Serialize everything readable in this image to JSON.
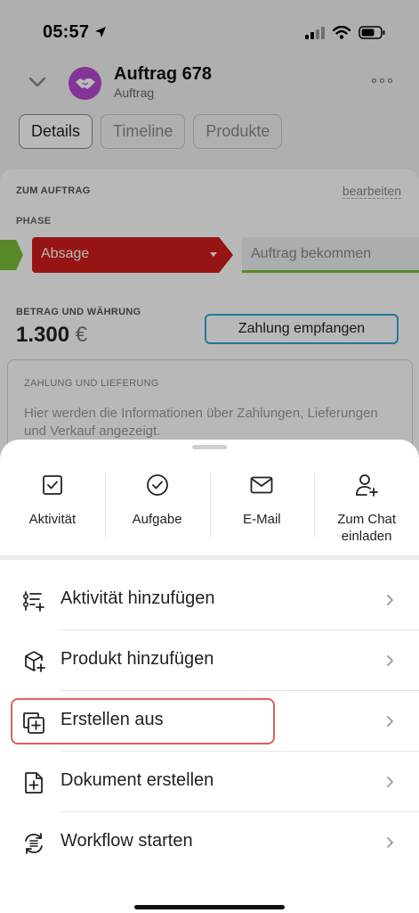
{
  "status_bar": {
    "time": "05:57"
  },
  "header": {
    "title": "Auftrag 678",
    "subtitle": "Auftrag"
  },
  "tabs": [
    {
      "label": "Details"
    },
    {
      "label": "Timeline"
    },
    {
      "label": "Produkte"
    }
  ],
  "deal_card": {
    "section_label": "ZUM AUFTRAG",
    "edit_label": "bearbeiten",
    "phase_label": "PHASE",
    "phase_current": "Absage",
    "phase_next": "Auftrag bekommen",
    "amount_label": "BETRAG UND WÄHRUNG",
    "amount_value": "1.300",
    "amount_currency": "€",
    "payment_button": "Zahlung empfangen",
    "payment_section_label": "ZAHLUNG UND LIEFERUNG",
    "payment_section_text": "Hier werden die Informationen über Zahlungen, Lieferungen und Verkauf angezeigt."
  },
  "sheet": {
    "quick_actions": [
      {
        "label": "Aktivität",
        "icon": "checkbox-icon"
      },
      {
        "label": "Aufgabe",
        "icon": "check-circle-icon"
      },
      {
        "label": "E-Mail",
        "icon": "envelope-icon"
      },
      {
        "label": "Zum Chat einladen",
        "icon": "add-person-icon"
      }
    ],
    "menu_items": [
      {
        "label": "Aktivität hinzufügen",
        "icon": "activity-add-icon"
      },
      {
        "label": "Produkt hinzufügen",
        "icon": "box-add-icon"
      },
      {
        "label": "Erstellen aus",
        "icon": "copy-add-icon",
        "highlighted": true
      },
      {
        "label": "Dokument erstellen",
        "icon": "document-add-icon"
      },
      {
        "label": "Workflow starten",
        "icon": "workflow-icon"
      }
    ]
  },
  "colors": {
    "phase_red": "#d11c1c",
    "phase_green": "#7bbe3a",
    "accent_blue": "#2fa7d8",
    "highlight_red": "#e0605a",
    "avatar_purple": "#b54ad0"
  }
}
